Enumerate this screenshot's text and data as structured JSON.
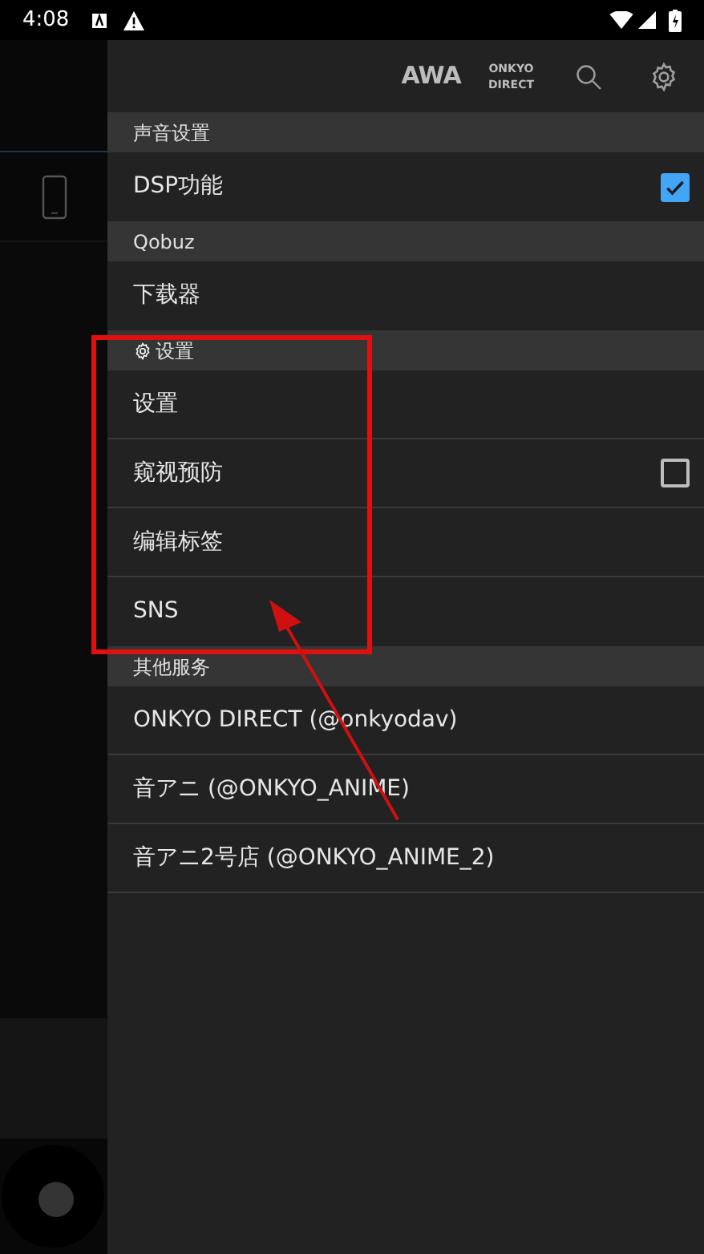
{
  "status_bar": {
    "time": "4:08"
  },
  "header": {
    "brand": "AWA",
    "direct_lines": [
      "ONKYO",
      "DIRECT"
    ]
  },
  "sections": [
    {
      "title": "声音设置",
      "kind": "plain",
      "items": [
        {
          "label": "DSP功能",
          "kind": "checkbox",
          "checked": true
        }
      ]
    },
    {
      "title": "Qobuz",
      "kind": "plain",
      "items": [
        {
          "label": "下载器",
          "kind": "plain"
        }
      ]
    },
    {
      "title": "设置",
      "kind": "gear",
      "items": [
        {
          "label": "设置",
          "kind": "plain"
        },
        {
          "label": "窥视预防",
          "kind": "checkbox",
          "checked": false
        },
        {
          "label": "编辑标签",
          "kind": "plain"
        },
        {
          "label": "SNS",
          "kind": "plain"
        }
      ]
    },
    {
      "title": "其他服务",
      "kind": "plain",
      "items": [
        {
          "label": "ONKYO DIRECT (@onkyodav)",
          "kind": "plain"
        },
        {
          "label": "音アニ (@ONKYO_ANIME)",
          "kind": "plain"
        },
        {
          "label": "音アニ2号店 (@ONKYO_ANIME_2)",
          "kind": "plain"
        }
      ]
    }
  ]
}
